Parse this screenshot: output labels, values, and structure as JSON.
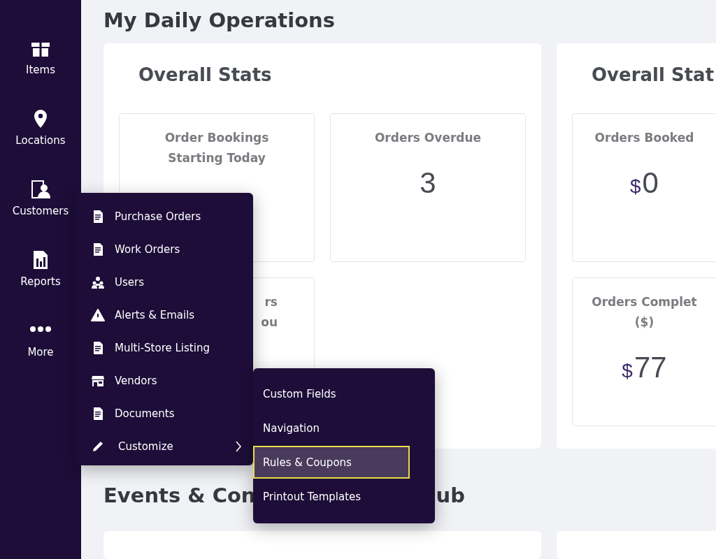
{
  "sidebar": {
    "items": [
      {
        "label": "Items"
      },
      {
        "label": "Locations"
      },
      {
        "label": "Customers"
      },
      {
        "label": "Reports"
      },
      {
        "label": "More"
      }
    ]
  },
  "page_title": "My Daily Operations",
  "cards": [
    {
      "title": "Overall Stats",
      "tiles": [
        {
          "title_lines": [
            "Order Bookings",
            "Starting Today"
          ],
          "kind": "stat"
        },
        {
          "title_lines": [
            "Orders Overdue"
          ],
          "value": "3",
          "kind": "stat"
        },
        {
          "title_lines": [
            "rs",
            "ou"
          ],
          "kind": "fragment"
        }
      ]
    },
    {
      "title": "Overall Stat",
      "tiles": [
        {
          "title_lines": [
            "Orders Booked"
          ],
          "currency": "$",
          "value": "0",
          "kind": "stat"
        },
        {
          "title_lines": [
            "Orders Complet",
            "($)"
          ],
          "currency": "$",
          "value": "77",
          "kind": "stat"
        }
      ]
    }
  ],
  "section_title": [
    "Events & Con",
    "ub"
  ],
  "menu": {
    "items": [
      {
        "label": "Purchase Orders",
        "has_submenu": false
      },
      {
        "label": "Work Orders",
        "has_submenu": false
      },
      {
        "label": "Users",
        "has_submenu": false
      },
      {
        "label": "Alerts & Emails",
        "has_submenu": false
      },
      {
        "label": "Multi-Store Listing",
        "has_submenu": false
      },
      {
        "label": "Vendors",
        "has_submenu": false
      },
      {
        "label": "Documents",
        "has_submenu": false
      },
      {
        "label": "Customize",
        "has_submenu": true
      }
    ]
  },
  "submenu": {
    "items": [
      {
        "label": "Custom Fields",
        "selected": false
      },
      {
        "label": "Navigation",
        "selected": false
      },
      {
        "label": "Rules & Coupons",
        "selected": true
      },
      {
        "label": "Printout Templates",
        "selected": false
      }
    ]
  }
}
